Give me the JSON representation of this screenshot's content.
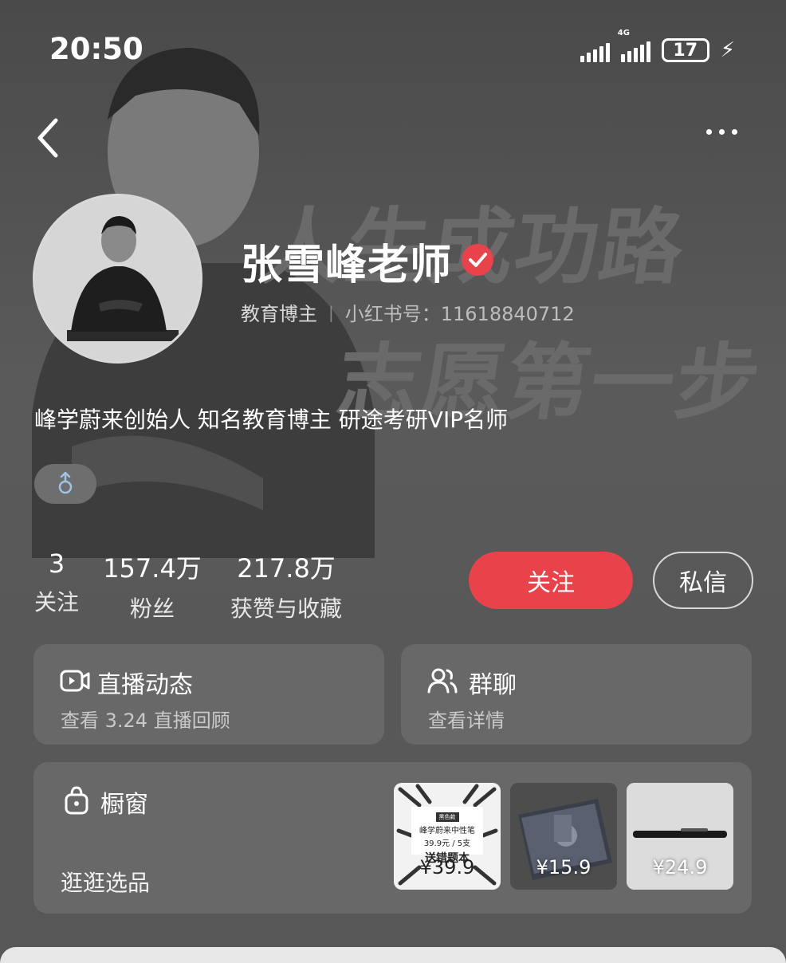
{
  "status_bar": {
    "time": "20:50",
    "network": "4G",
    "battery": "17",
    "icons": [
      "signal-icon",
      "signal-4g-icon",
      "battery-icon",
      "charging-bolt-icon"
    ]
  },
  "header": {
    "back_icon": "chevron-left-icon",
    "more_icon": "more-dots-icon"
  },
  "background": {
    "slogan_line1": "人生成功路",
    "slogan_line2": "志愿第一步"
  },
  "profile": {
    "name": "张雪峰老师",
    "verified_icon": "verified-badge-icon",
    "role": "教育博主",
    "separator": "|",
    "red_id": "小红书号：11618840712",
    "bio": "峰学蔚来创始人 知名教育博主 研途考研VIP名师",
    "gender_icon": "male-icon",
    "gender_color": "#9fc3e6"
  },
  "stats": [
    {
      "num": "3",
      "label": "关注"
    },
    {
      "num": "157.4万",
      "label": "粉丝"
    },
    {
      "num": "217.8万",
      "label": "获赞与收藏"
    }
  ],
  "actions": {
    "follow_label": "关注",
    "message_label": "私信",
    "accent_color": "#e8434b"
  },
  "cards": {
    "live": {
      "title": "直播动态",
      "sub": "查看 3.24 直播回顾",
      "icon": "video-play-icon"
    },
    "group": {
      "title": "群聊",
      "sub": "查看详情",
      "icon": "group-users-icon"
    },
    "shop": {
      "title": "橱窗",
      "sub": "逛逛选品",
      "icon": "shopping-bag-icon",
      "products": [
        {
          "price": "¥39.9",
          "tag": "黑色款",
          "line1": "峰学蔚来中性笔",
          "line2": "39.9元 / 5支",
          "line3": "送错题本"
        },
        {
          "price": "¥15.9"
        },
        {
          "price": "¥24.9"
        }
      ]
    }
  }
}
